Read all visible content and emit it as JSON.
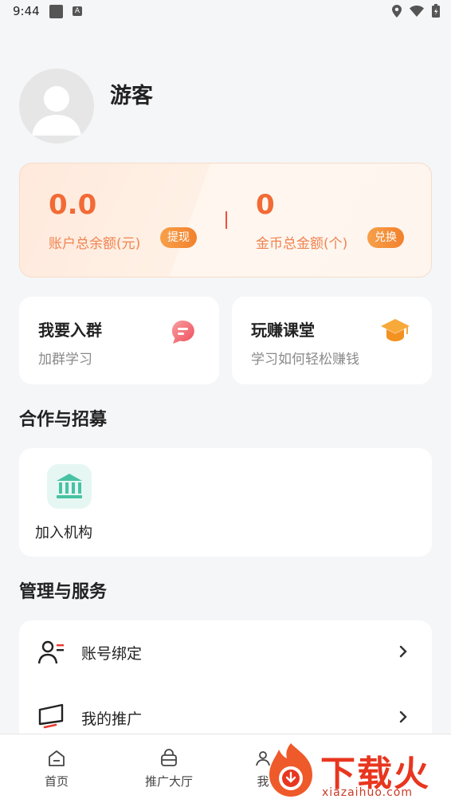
{
  "status_bar": {
    "time": "9:44",
    "a_glyph": "A",
    "icons": [
      "location-icon",
      "wifi-icon",
      "battery-icon"
    ]
  },
  "profile": {
    "name": "游客"
  },
  "balance": {
    "account_value": "0.0",
    "account_label": "账户总余额(元)",
    "withdraw_label": "提现",
    "coins_value": "0",
    "coins_label": "金币总金额(个)",
    "exchange_label": "兑换"
  },
  "quick_cards": [
    {
      "title": "我要入群",
      "subtitle": "加群学习",
      "icon": "chat-bubble-icon"
    },
    {
      "title": "玩赚课堂",
      "subtitle": "学习如何轻松赚钱",
      "icon": "graduation-cap-icon"
    }
  ],
  "cooperation": {
    "title": "合作与招募",
    "items": [
      {
        "label": "加入机构",
        "icon": "institution-icon"
      }
    ]
  },
  "services": {
    "title": "管理与服务",
    "items": [
      {
        "label": "账号绑定",
        "icon": "account-icon"
      },
      {
        "label": "我的推广",
        "icon": "megaphone-icon"
      }
    ]
  },
  "bottom_nav": [
    {
      "label": "首页",
      "icon": "home-icon"
    },
    {
      "label": "推广大厅",
      "icon": "hall-icon"
    },
    {
      "label": "我",
      "icon": "user-icon"
    }
  ],
  "watermark": {
    "text": "下载火",
    "sub": "xiazaihuo.com"
  },
  "colors": {
    "accent": "#f26a35",
    "card_bg": "#fff1e6",
    "teal": "#49c2a4",
    "watermark": "#e8361f"
  }
}
